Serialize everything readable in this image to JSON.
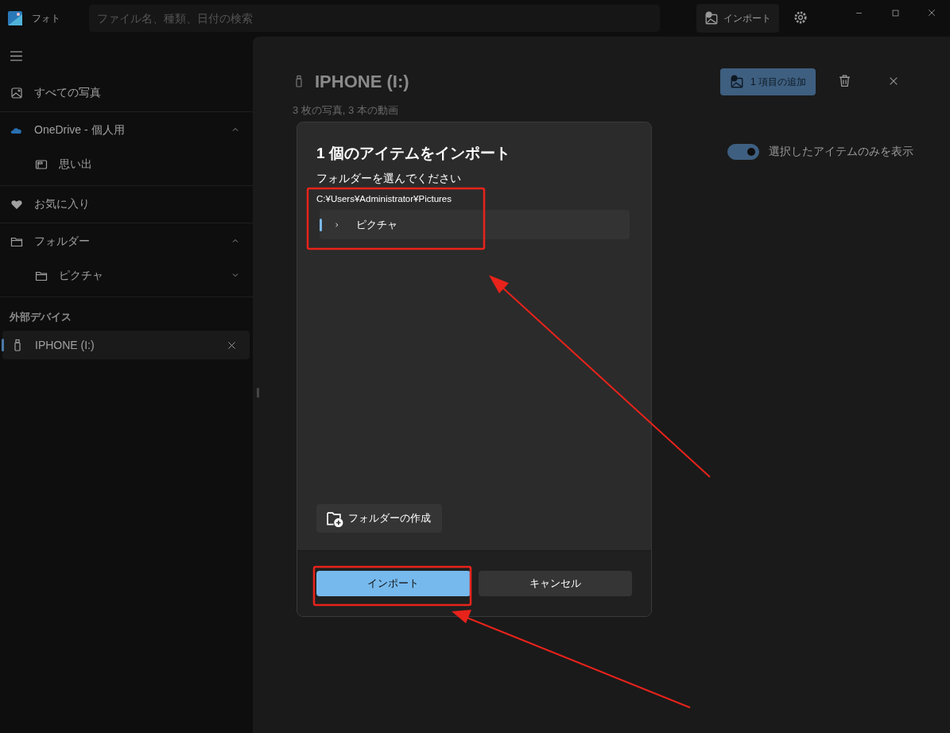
{
  "window": {
    "app_name": "フォト",
    "search": {
      "placeholder": "ファイル名、種類、日付の検索"
    },
    "import_button": "インポート"
  },
  "sidebar": {
    "items": [
      {
        "label": "すべての写真"
      },
      {
        "label": "OneDrive - 個人用",
        "expanded": true,
        "children": [
          {
            "label": "思い出"
          }
        ]
      },
      {
        "label": "お気に入り"
      },
      {
        "label": "フォルダー",
        "expanded": true,
        "children": [
          {
            "label": "ピクチャ",
            "expanded": false
          }
        ]
      }
    ],
    "section_title": "外部デバイス",
    "devices": [
      {
        "label": "IPHONE (I:)",
        "selected": true
      }
    ]
  },
  "main": {
    "title": "IPHONE (I:)",
    "subtitle": "3 枚の写真, 3 本の動画",
    "add_button": "1 項目の追加",
    "toggle": {
      "label": "選択したアイテムのみを表示",
      "on": true
    }
  },
  "dialog": {
    "title": "1 個のアイテムをインポート",
    "subtitle": "フォルダーを選んでください",
    "path": "C:¥Users¥Administrator¥Pictures",
    "tree": [
      {
        "label": "ピクチャ",
        "expanded": false,
        "selected": true
      }
    ],
    "create_folder_button": "フォルダーの作成",
    "buttons": [
      {
        "label": "インポート",
        "kind": "primary"
      },
      {
        "label": "キャンセル",
        "kind": "secondary"
      }
    ]
  }
}
